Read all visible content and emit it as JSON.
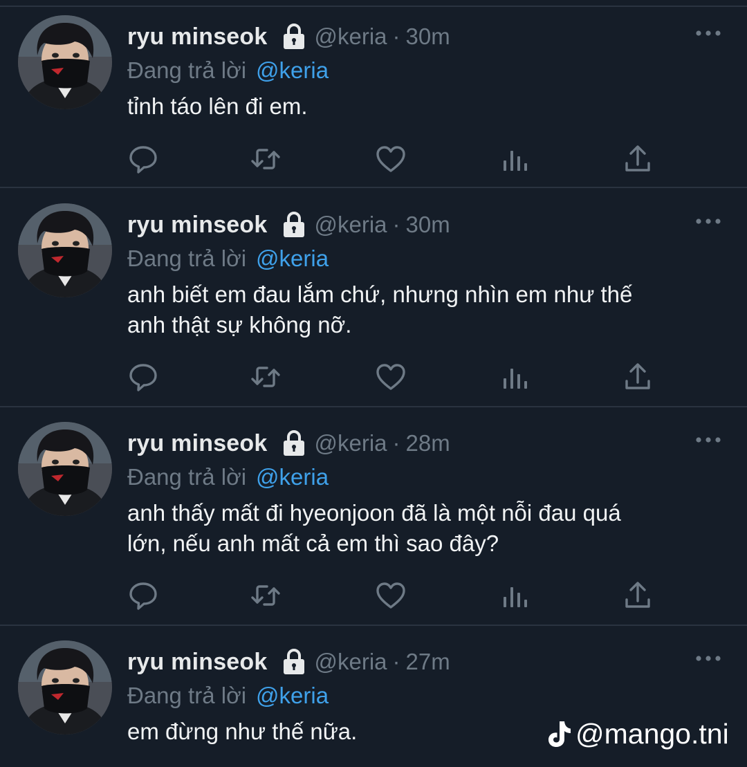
{
  "colors": {
    "background": "#151d28",
    "divider": "#2a3340",
    "primary_text": "#e7e9ea",
    "secondary_text": "#6e7a86",
    "accent": "#3fa1ea"
  },
  "tweets": [
    {
      "display_name": "ryu minseok",
      "handle": "@keria",
      "separator": "·",
      "time": "30m",
      "reply_prefix": "Đang trả lời",
      "reply_to": "@keria",
      "text": "tỉnh táo lên đi em."
    },
    {
      "display_name": "ryu minseok",
      "handle": "@keria",
      "separator": "·",
      "time": "30m",
      "reply_prefix": "Đang trả lời",
      "reply_to": "@keria",
      "text": "anh biết em đau lắm chứ, nhưng nhìn em như thế\nanh thật sự không nỡ."
    },
    {
      "display_name": "ryu minseok",
      "handle": "@keria",
      "separator": "·",
      "time": "28m",
      "reply_prefix": "Đang trả lời",
      "reply_to": "@keria",
      "text": "anh thấy mất đi hyeonjoon đã là một nỗi đau quá\nlớn, nếu anh mất cả em thì sao đây?"
    },
    {
      "display_name": "ryu minseok",
      "handle": "@keria",
      "separator": "·",
      "time": "27m",
      "reply_prefix": "Đang trả lời",
      "reply_to": "@keria",
      "text": "em đừng như thế nữa."
    }
  ],
  "icons": {
    "lock": "lock-icon",
    "more": "more-options-icon",
    "reply": "reply-icon",
    "retweet": "retweet-icon",
    "like": "heart-icon",
    "analytics": "analytics-icon",
    "share": "share-icon",
    "watermark": "tiktok-icon"
  },
  "watermark": {
    "text": "@mango.tni"
  }
}
